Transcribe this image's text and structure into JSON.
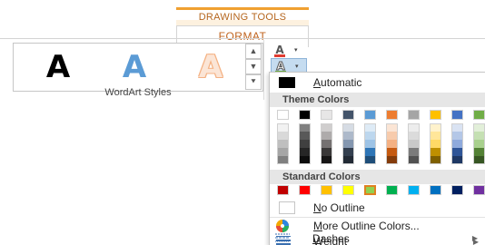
{
  "contextual_tab": {
    "group_title": "DRAWING TOOLS",
    "tab_label": "FORMAT"
  },
  "wordart_gallery": {
    "group_label": "WordArt Styles",
    "samples": [
      {
        "letter": "A",
        "style": "black-fill"
      },
      {
        "letter": "A",
        "style": "blue-fill"
      },
      {
        "letter": "A",
        "style": "orange-outline"
      }
    ],
    "scroll_buttons": [
      {
        "icon": "scroll-up-icon",
        "glyph": "▲"
      },
      {
        "icon": "scroll-down-icon",
        "glyph": "▼"
      },
      {
        "icon": "gallery-more-icon",
        "glyph": "⯆"
      }
    ]
  },
  "text_tools": {
    "text_fill": {
      "glyph": "A",
      "bar_color": "#e03c31",
      "arrow": "▾"
    },
    "text_outline": {
      "glyph": "A",
      "bar_color": "#70ad47",
      "arrow": "▾"
    }
  },
  "outline_menu": {
    "automatic_label": "Automatic",
    "automatic_accel": "A",
    "theme_header": "Theme Colors",
    "theme_base": [
      "#ffffff",
      "#000000",
      "#e7e6e6",
      "#44546a",
      "#5b9bd5",
      "#ed7d31",
      "#a5a5a5",
      "#ffc000",
      "#4472c4",
      "#70ad47"
    ],
    "theme_shades": [
      [
        "#f2f2f2",
        "#d9d9d9",
        "#bfbfbf",
        "#a6a6a6",
        "#808080"
      ],
      [
        "#808080",
        "#595959",
        "#404040",
        "#262626",
        "#0d0d0d"
      ],
      [
        "#d0cece",
        "#aeabab",
        "#757171",
        "#3a3838",
        "#171616"
      ],
      [
        "#d6dce4",
        "#adb9ca",
        "#8497b0",
        "#333f4f",
        "#222a35"
      ],
      [
        "#deebf6",
        "#bdd7ee",
        "#9dc3e6",
        "#2e75b6",
        "#1f4e79"
      ],
      [
        "#fbe5d5",
        "#f7cbac",
        "#f4b183",
        "#c55a11",
        "#843c0b"
      ],
      [
        "#ededed",
        "#dbdbdb",
        "#c9c9c9",
        "#7b7b7b",
        "#525252"
      ],
      [
        "#fff2cc",
        "#ffe699",
        "#ffd966",
        "#bf9000",
        "#7f6000"
      ],
      [
        "#dae3f3",
        "#b4c7e7",
        "#8faadc",
        "#2f5597",
        "#1f3864"
      ],
      [
        "#e2efd9",
        "#c5e0b3",
        "#a8d08d",
        "#538135",
        "#375623"
      ]
    ],
    "standard_header": "Standard Colors",
    "standard_colors": [
      "#c00000",
      "#ff0000",
      "#ffc000",
      "#ffff00",
      "#92d050",
      "#00b050",
      "#00b0f0",
      "#0070c0",
      "#002060",
      "#7030a0"
    ],
    "selected_standard_index": 4,
    "no_outline_label": "No Outline",
    "no_outline_accel": "N",
    "more_colors_label": "More Outline Colors...",
    "more_colors_accel": "M",
    "weight_label": "Weight",
    "weight_accel": "W",
    "dashes_label": "Dashes",
    "dashes_accel": "D",
    "submenu_arrow": "▶"
  }
}
